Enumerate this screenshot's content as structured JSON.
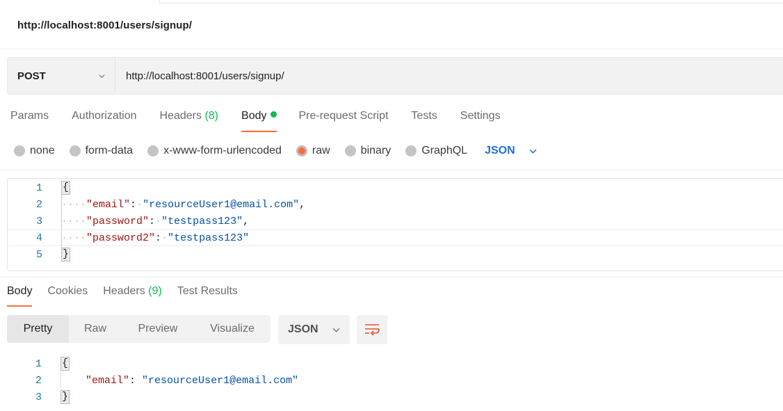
{
  "request": {
    "title": "http://localhost:8001/users/signup/",
    "method": "POST",
    "url": "http://localhost:8001/users/signup/"
  },
  "request_tabs": [
    {
      "label": "Params"
    },
    {
      "label": "Authorization"
    },
    {
      "label": "Headers",
      "count": "(8)"
    },
    {
      "label": "Body",
      "active": true,
      "indicator": "green-dot"
    },
    {
      "label": "Pre-request Script"
    },
    {
      "label": "Tests"
    },
    {
      "label": "Settings"
    }
  ],
  "body_types": {
    "options": [
      "none",
      "form-data",
      "x-www-form-urlencoded",
      "raw",
      "binary",
      "GraphQL"
    ],
    "selected": "raw",
    "format": "JSON"
  },
  "request_body": {
    "lines": [
      {
        "n": "1",
        "text": "{"
      },
      {
        "n": "2",
        "key": "\"email\"",
        "value": "\"resourceUser1@email.com\"",
        "trail": ","
      },
      {
        "n": "3",
        "key": "\"password\"",
        "value": "\"testpass123\"",
        "trail": ","
      },
      {
        "n": "4",
        "key": "\"password2\"",
        "value": "\"testpass123\"",
        "trail": ""
      },
      {
        "n": "5",
        "text": "}"
      }
    ]
  },
  "response_tabs": [
    {
      "label": "Body",
      "active": true
    },
    {
      "label": "Cookies"
    },
    {
      "label": "Headers",
      "count": "(9)"
    },
    {
      "label": "Test Results"
    }
  ],
  "response_view": {
    "modes": [
      "Pretty",
      "Raw",
      "Preview",
      "Visualize"
    ],
    "selected": "Pretty",
    "format": "JSON",
    "wrap_icon": "wrap-lines-icon"
  },
  "response_body": {
    "lines": [
      {
        "n": "1",
        "text": "{"
      },
      {
        "n": "2",
        "key": "\"email\"",
        "value": "\"resourceUser1@email.com\""
      },
      {
        "n": "3",
        "text": "}"
      }
    ]
  },
  "colors": {
    "accent": "#ff6c37",
    "success": "#0cbb52",
    "link": "#1f6fdb",
    "json_key": "#a31515",
    "json_string": "#0451a5",
    "line_number": "#237893"
  }
}
